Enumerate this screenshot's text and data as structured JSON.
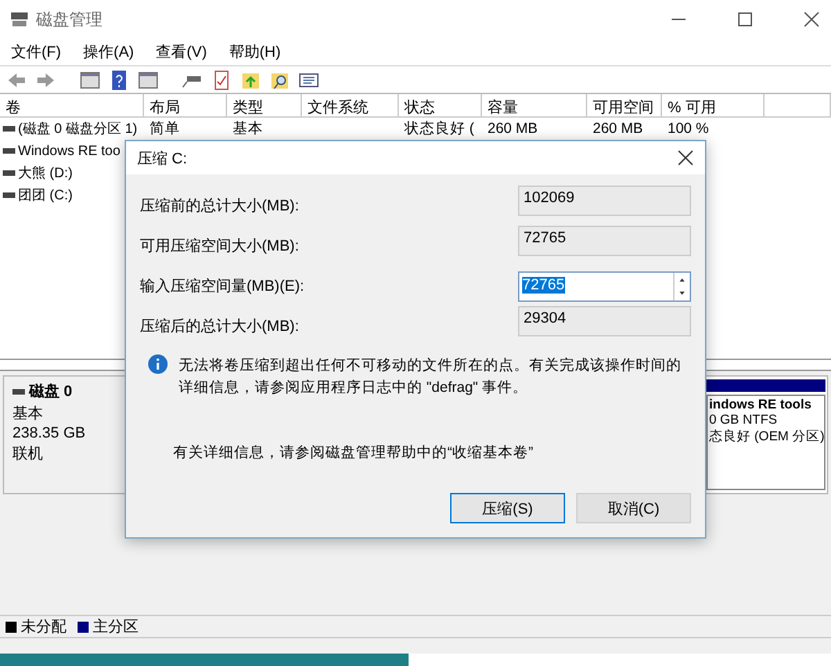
{
  "window": {
    "title": "磁盘管理"
  },
  "menu": [
    "文件(F)",
    "操作(A)",
    "查看(V)",
    "帮助(H)"
  ],
  "volume_list": {
    "columns": [
      "卷",
      "布局",
      "类型",
      "文件系统",
      "状态",
      "容量",
      "可用空间",
      "% 可用"
    ],
    "rows": [
      {
        "cells": [
          "(磁盘 0 磁盘分区 1)",
          "简单",
          "基本",
          "",
          "状态良好 (",
          "260 MB",
          "260 MB",
          "100 %"
        ]
      },
      {
        "cells": [
          "Windows RE too"
        ]
      },
      {
        "cells": [
          "大熊 (D:)"
        ]
      },
      {
        "cells": [
          "团团 (C:)"
        ]
      }
    ]
  },
  "disk_map": {
    "disk": {
      "name": "磁盘 0",
      "type": "基本",
      "size": "238.35 GB",
      "status": "联机"
    },
    "partitions": [
      {
        "name": "indows RE tools",
        "detail": "0 GB NTFS",
        "status": "态良好 (OEM 分区)",
        "color": "#000080"
      }
    ],
    "legend": [
      {
        "label": "未分配",
        "color": "#000000"
      },
      {
        "label": "主分区",
        "color": "#000080"
      }
    ]
  },
  "dialog": {
    "title": "压缩 C:",
    "fields": [
      {
        "label": "压缩前的总计大小(MB):",
        "value": "102069",
        "kind": "readonly"
      },
      {
        "label": "可用压缩空间大小(MB):",
        "value": "72765",
        "kind": "readonly"
      },
      {
        "label": "输入压缩空间量(MB)(E):",
        "value": "72765",
        "kind": "spin"
      },
      {
        "label": "压缩后的总计大小(MB):",
        "value": "29304",
        "kind": "readonly"
      }
    ],
    "info": "无法将卷压缩到超出任何不可移动的文件所在的点。有关完成该操作时间的详细信息，请参阅应用程序日志中的 \"defrag\" 事件。",
    "help": "有关详细信息，请参阅磁盘管理帮助中的“收缩基本卷”",
    "buttons": [
      {
        "label": "压缩(S)",
        "default": true
      },
      {
        "label": "取消(C)",
        "default": false
      }
    ]
  }
}
